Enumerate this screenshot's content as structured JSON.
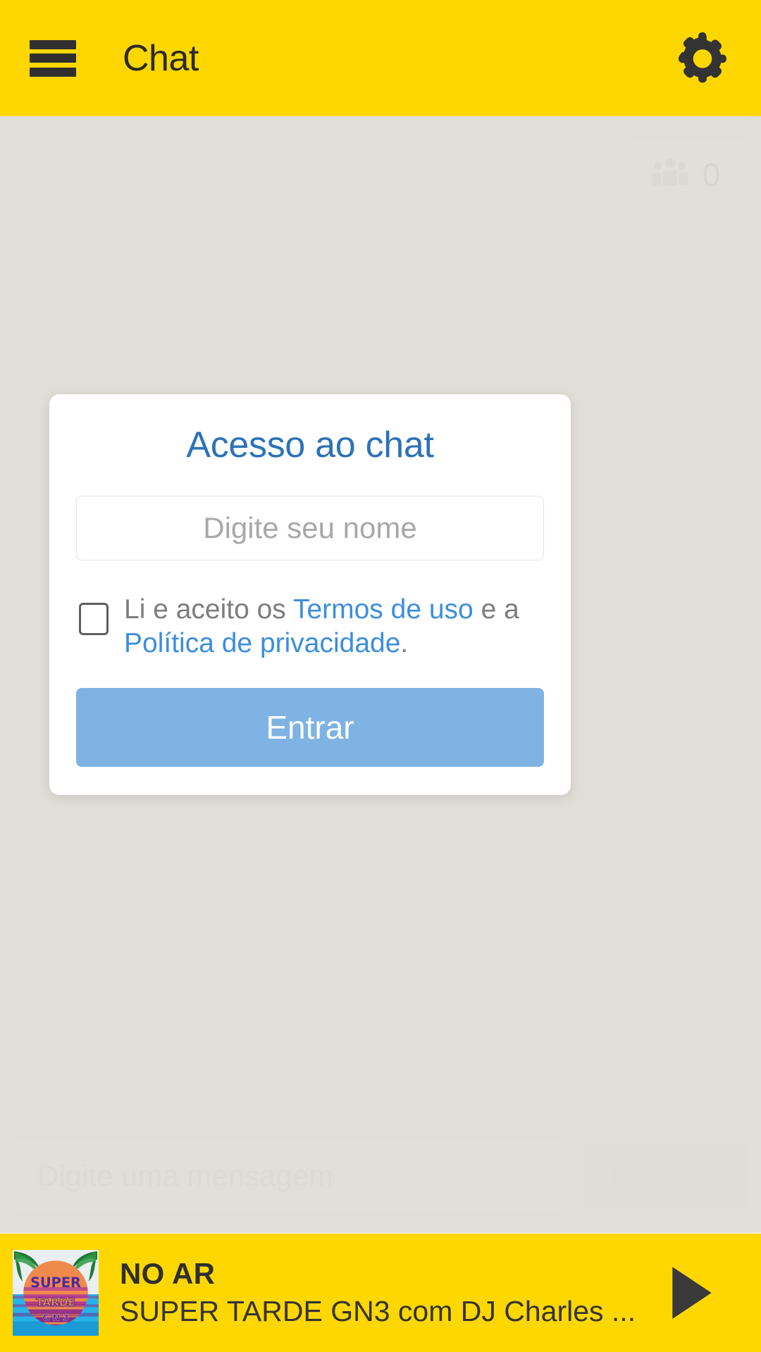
{
  "header": {
    "title": "Chat",
    "menu_icon": "hamburger-menu-icon",
    "settings_icon": "gear-icon"
  },
  "chat": {
    "people_icon": "people-group-icon",
    "people_count": "0",
    "composer": {
      "placeholder": "Digite uma mensagem",
      "send_label": "ENVIAR"
    }
  },
  "modal": {
    "title": "Acesso ao chat",
    "name_placeholder": "Digite seu nome",
    "name_value": "",
    "terms": {
      "prefix": "Li e aceito os ",
      "link_terms": "Termos de uso",
      "middle": " e a ",
      "link_privacy": "Política de privacidade",
      "suffix": "."
    },
    "checkbox_checked": false,
    "submit_label": "Entrar"
  },
  "player": {
    "live_label": "NO AR",
    "track_title": "SUPER TARDE GN3 com DJ Charles ...",
    "play_icon": "play-icon",
    "artwork": {
      "line1": "SUPER",
      "line2": "TARDE",
      "line3": "G N 3"
    }
  },
  "colors": {
    "brand_yellow": "#ffd700",
    "accent_blue": "#2c72b8",
    "button_blue": "#7eb3e3",
    "link_blue": "#3c8ede",
    "dark": "#2f2f2f",
    "page_bg": "#e0dcd6"
  }
}
